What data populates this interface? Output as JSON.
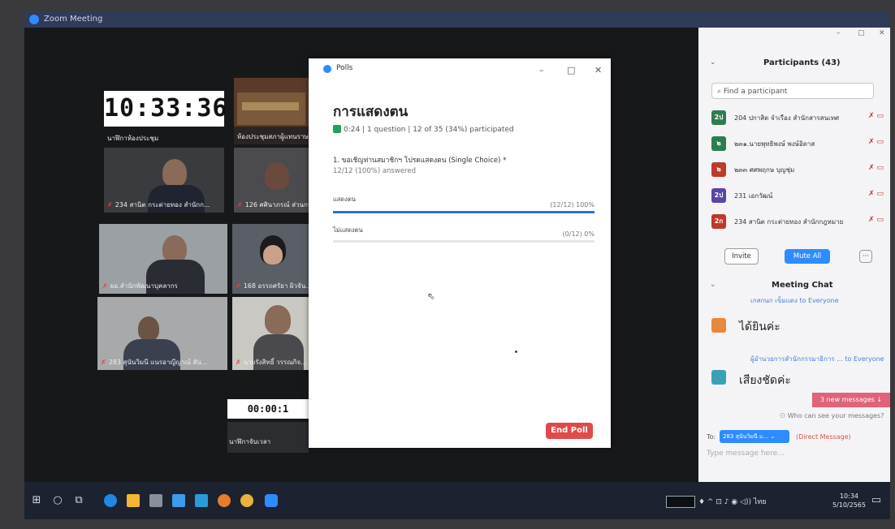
{
  "window": {
    "title": "Zoom Meeting"
  },
  "gallery": {
    "clock": "10:33:36",
    "clock_label": "นาฬิกาห้องประชุม",
    "room_label": "ห้องประชุมสภาผู้แทนราษฎร",
    "tiles": [
      {
        "name": "234 สานิต กระต่ายทอง สำนักก..."
      },
      {
        "name": "126 ศศินาภรณ์ ส่วนกร..."
      },
      {
        "name": "ผอ.สำนักพัฒนาบุคลากร"
      },
      {
        "name": "168 อรรถศรัยา ผิวจัน..."
      },
      {
        "name": "283 สุนันวิมนี แนรอาญีญาณ์ สัน..."
      },
      {
        "name": "นายรังสิทธิ์ วรรณกิจ..."
      }
    ],
    "timer": "00:00:1",
    "timer_label": "นาฬิกาจับเวลา"
  },
  "polls": {
    "window_title": "Polls",
    "title": "การแสดงตน",
    "meta": "0:24 | 1 question | 12 of 35 (34%) participated",
    "question": "1. ขอเชิญท่านสมาชิกฯ โปรดแสดงตน (Single Choice) *",
    "answered": "12/12 (100%) answered",
    "options": [
      {
        "label": "แสดงตน",
        "count": "(12/12) 100%",
        "fraction": 1.0
      },
      {
        "label": "ไม่แสดงตน",
        "count": "(0/12) 0%",
        "fraction": 0.0
      }
    ],
    "end_button": "End Poll"
  },
  "participants": {
    "title": "Participants (43)",
    "search_placeholder": "Find a participant",
    "list": [
      {
        "avatar": "2ป",
        "name": "204 ปกาสิต จำเรือง สำนักสารสนเทศ",
        "color": "#2e7d4f"
      },
      {
        "avatar": "๒",
        "name": "๒๓๑.นายพุทธิพงษ์ พงษ์อิดาส",
        "color": "#2e7d4f"
      },
      {
        "avatar": "๒",
        "name": "๒๓๓ ศศพฤกษ บุญชุ่ม",
        "color": "#c0392b"
      },
      {
        "avatar": "2ป",
        "name": "231 เอกวัฒน์",
        "color": "#5b45a8"
      },
      {
        "avatar": "2ก",
        "name": "234 สานิต กระต่ายทอง สำนักกฎหมาย",
        "color": "#c0392b"
      }
    ],
    "invite": "Invite",
    "mute_all": "Mute All",
    "more": "···"
  },
  "chat": {
    "title": "Meeting Chat",
    "messages": [
      {
        "sender": "เกสกนก เข็มแดง to Everyone",
        "text": "ได้ยินค่ะ",
        "avatar_color": "#e8883a"
      },
      {
        "sender": "ผู้อำนวยการสำนักกรรมาธิการ ... to Everyone",
        "text": "เสียงชัดค่ะ",
        "avatar_color": "#3aa0b8"
      }
    ],
    "new_messages": "3 new messages ↓",
    "who_can_see": "Who can see your messages?",
    "to_label": "To:",
    "to_recipient": "283 สุนันวิมนี แ...",
    "dm_label": "(Direct Message)",
    "input_placeholder": "Type message here..."
  },
  "taskbar": {
    "time": "10:34",
    "date": "5/10/2565",
    "lang": "ไทย"
  }
}
